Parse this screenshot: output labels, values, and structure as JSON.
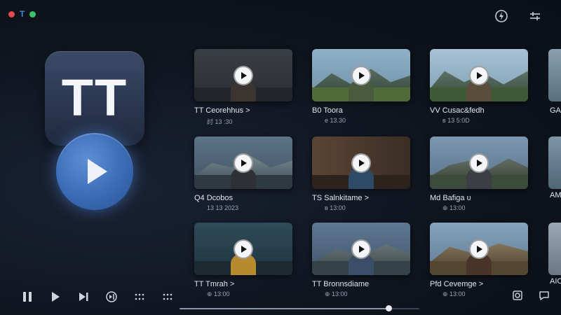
{
  "window": {
    "mark": "T"
  },
  "brand": {
    "logo_text": "TT"
  },
  "videos": [
    {
      "title": "TT Ceorehhus >",
      "meta": "討 13 :30"
    },
    {
      "title": "B0 Toora",
      "meta": "е 13.30"
    },
    {
      "title": "VV Cusac&fedh",
      "meta": "в 13 5:0D"
    },
    {
      "title": "Q4 Dcobos",
      "meta": "13 13 2023"
    },
    {
      "title": "TS Salnkitame >",
      "meta": "в 13:00"
    },
    {
      "title": "Md Bafiga υ",
      "meta": "⊕ 13:00"
    },
    {
      "title": "TT Tmrah >",
      "meta": "⊕ 13:00"
    },
    {
      "title": "TT Bronnsdiame",
      "meta": "⊕ 13:00"
    },
    {
      "title": "Pfd Cevemge >",
      "meta": "⊕ 13:00"
    }
  ],
  "edge_titles": [
    "GA",
    "AM",
    "AIC"
  ],
  "playback": {
    "progress": 0.87
  },
  "colors": {
    "accent": "#3a6bb5",
    "background": "#0f1420"
  }
}
